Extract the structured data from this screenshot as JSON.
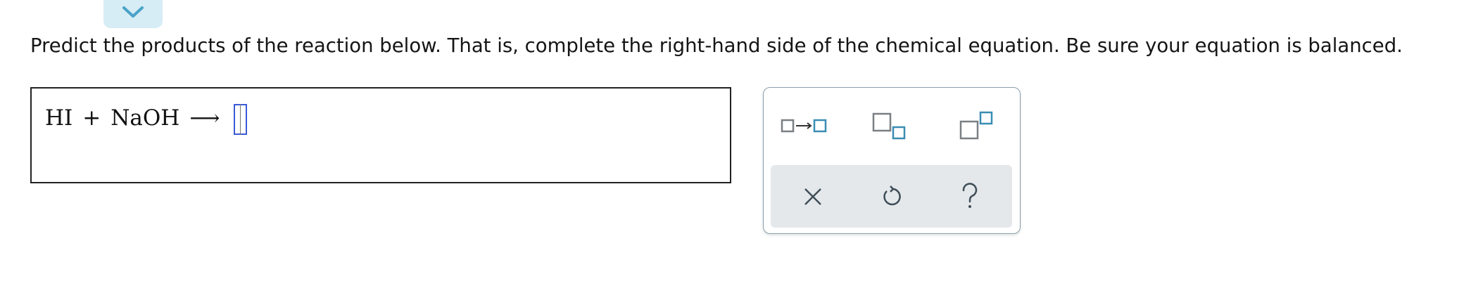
{
  "collapse_tab": {
    "icon": "chevron-down-icon",
    "color": "#4aa3c8"
  },
  "prompt": {
    "text": "Predict the products of the reaction below. That is, complete the right-hand side of the chemical equation. Be sure your equation is balanced."
  },
  "equation": {
    "reactant_1": "HI",
    "plus": "+",
    "reactant_2": "NaOH",
    "arrow": "⟶"
  },
  "palette": {
    "tools": [
      {
        "name": "reaction-arrow-template",
        "icon": "box-arrow-box-icon"
      },
      {
        "name": "subscript-template",
        "icon": "subscript-icon"
      },
      {
        "name": "superscript-template",
        "icon": "superscript-icon"
      }
    ],
    "actions": [
      {
        "name": "clear",
        "icon": "close-icon"
      },
      {
        "name": "undo",
        "icon": "undo-icon"
      },
      {
        "name": "help",
        "icon": "help-icon"
      }
    ],
    "colors": {
      "template_gray": "#7a7f83",
      "template_blue": "#3a8db3",
      "action_gray": "#3f4d57"
    }
  }
}
